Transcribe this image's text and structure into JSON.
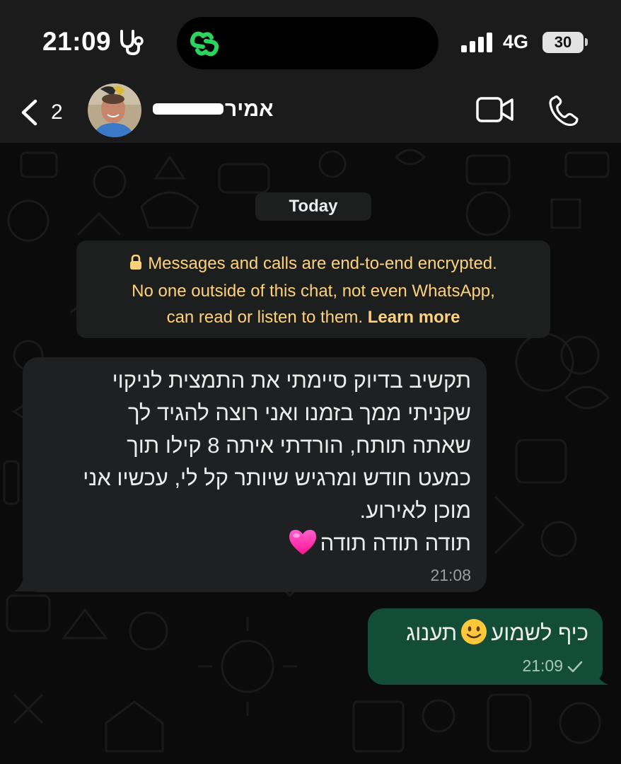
{
  "status_bar": {
    "time": "21:09",
    "network": "4G",
    "battery_level": "30",
    "icons": [
      "stethoscope-icon",
      "app-indicator-icon",
      "signal-icon",
      "battery-icon"
    ]
  },
  "header": {
    "back_count": "2",
    "contact_name": "אמיר",
    "icons": [
      "chevron-left-icon",
      "video-camera-icon",
      "phone-icon"
    ]
  },
  "chat": {
    "date_separator": "Today",
    "encryption_notice": {
      "line1": "Messages and calls are end-to-end encrypted.",
      "line2": "No one outside of this chat, not even WhatsApp,",
      "line3": "can read or listen to them.",
      "link": "Learn more"
    },
    "messages": [
      {
        "direction": "incoming",
        "lines": [
          "תקשיב בדיוק סיימתי את התמצית לניקוי",
          "שקניתי ממך בזמנו ואני רוצה להגיד לך",
          "שאתה תותח, הורדתי איתה 8 קילו תוך",
          "כמעט חודש ומרגיש שיותר קל לי, עכשיו אני",
          "מוכן לאירוע.",
          "תודה תודה תודה"
        ],
        "emoji": "pink-heart",
        "time": "21:08"
      },
      {
        "direction": "outgoing",
        "text_start": "כיף לשמוע",
        "text_end": "תענוג",
        "emoji": "smiling-face",
        "time": "21:09",
        "status": "sent"
      }
    ]
  },
  "colors": {
    "header_bg": "#1b1b1b",
    "chat_bg": "#0b0b0b",
    "incoming_bubble": "#1f2021",
    "outgoing_bubble": "#144d37",
    "notice_text": "#ffd279",
    "app_indicator": "#2bd45f"
  }
}
